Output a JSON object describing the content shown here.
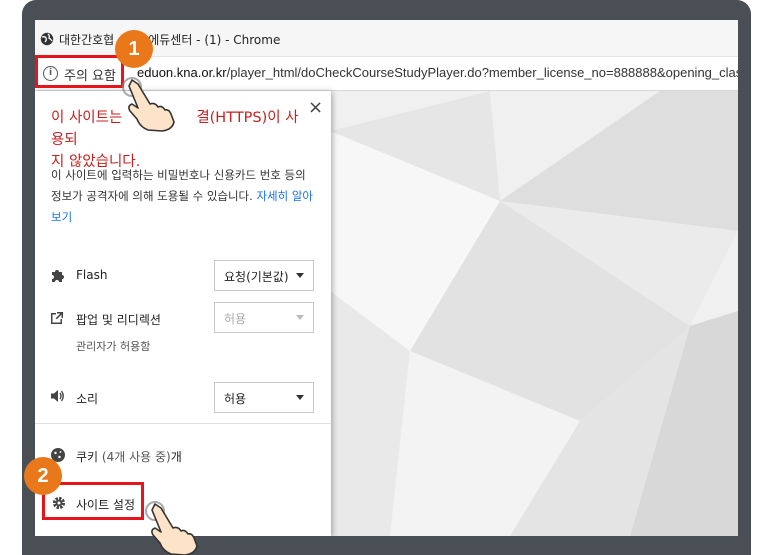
{
  "window": {
    "title": "대한간호협회 에듀센터 - (1) - Chrome",
    "title_left": "대한간호협",
    "title_right": "에듀센터 - (1) - Chrome"
  },
  "omnibox": {
    "security_label": "주의 요함",
    "url_host": "eduon.kna.or.kr",
    "url_path": "/player_html/doCheckCourseStudyPlayer.do?member_license_no=888888&opening_clas"
  },
  "popup": {
    "close_label": "×",
    "heading_line1": "이 사이트는",
    "heading_mid": "결(HTTPS)이 사용되",
    "heading_line2": "지 않았습니다.",
    "description": "이 사이트에 입력하는 비밀번호나 신용카드 번호 등의 정보가 공격자에 의해 도용될 수 있습니다.",
    "learn_more": "자세히 알아보기",
    "permissions": [
      {
        "icon": "puzzle-icon",
        "label": "Flash",
        "value": "요청(기본값)",
        "enabled": true
      },
      {
        "icon": "popup-icon",
        "label": "팝업 및 리디렉션",
        "sublabel": "관리자가 허용함",
        "value": "허용",
        "enabled": false
      },
      {
        "icon": "speaker-icon",
        "label": "소리",
        "value": "허용",
        "enabled": true
      }
    ],
    "cookies_label": "쿠키",
    "cookies_detail": "(4개 사용 중)",
    "cookies_suffix": "개",
    "site_settings_label": "사이트 설정"
  },
  "annotations": {
    "step1": "1",
    "step2": "2",
    "badge_color": "#e8781a",
    "highlight_color": "#e8141b"
  }
}
